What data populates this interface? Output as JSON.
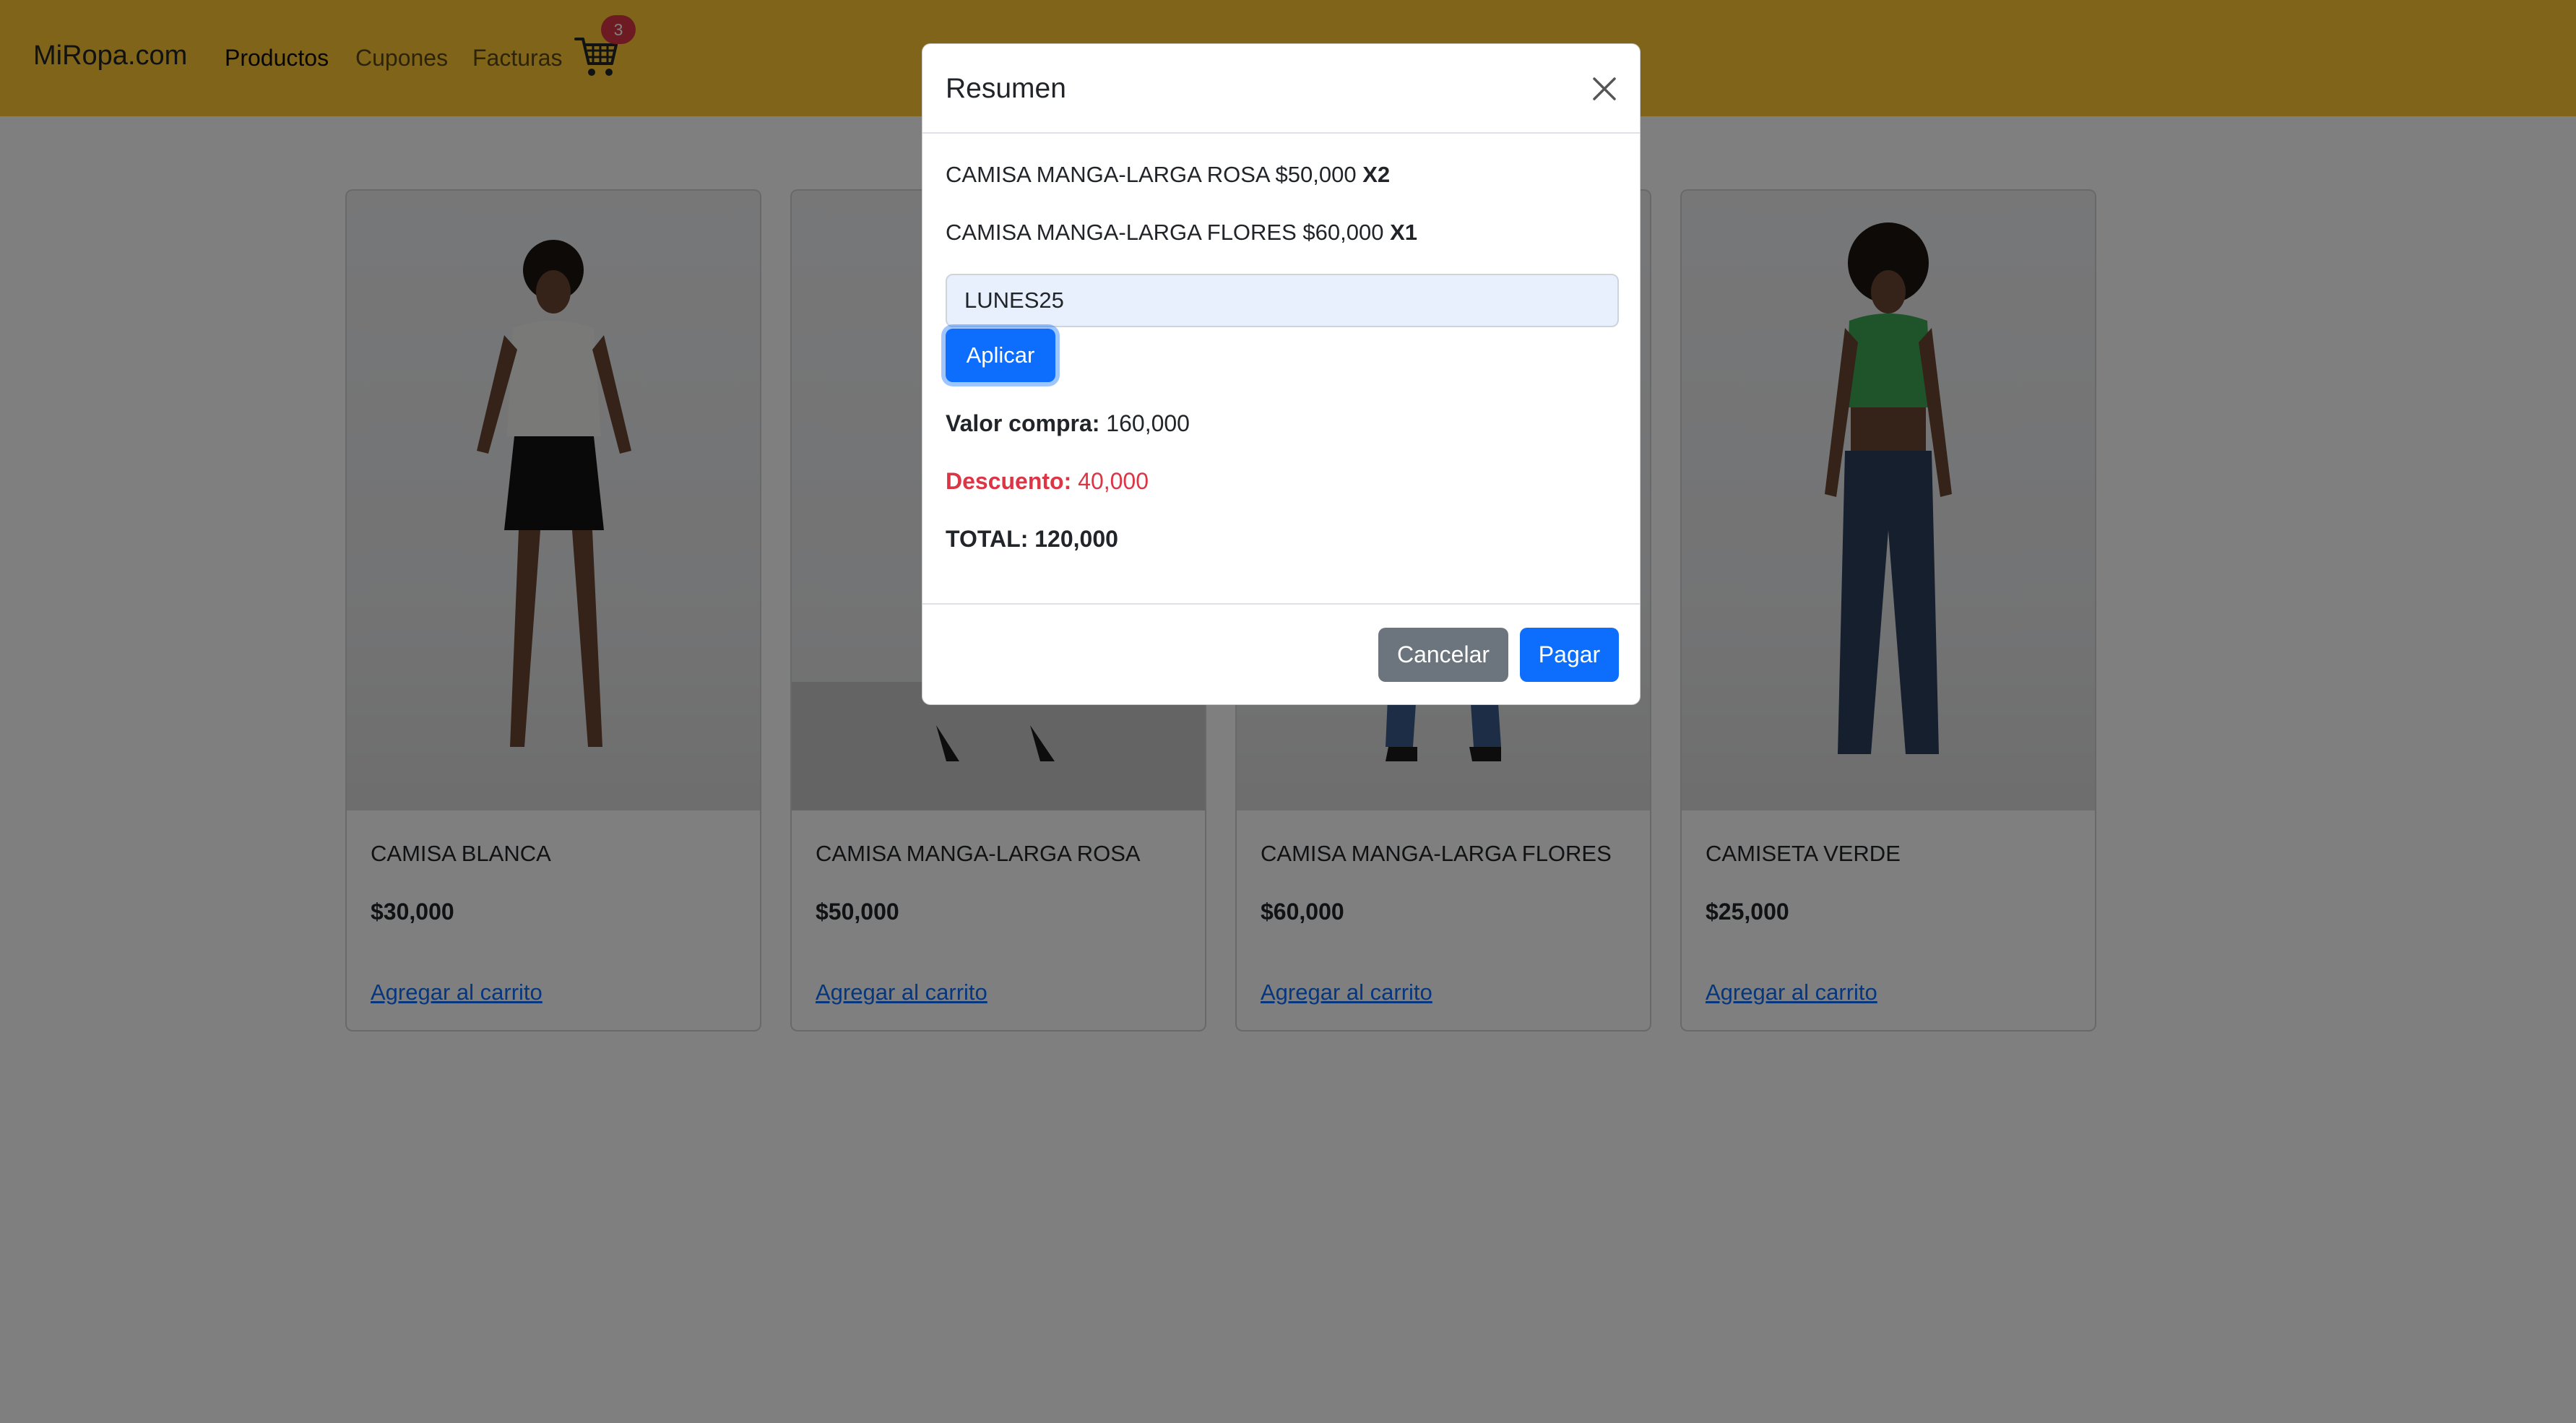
{
  "navbar": {
    "brand": "MiRopa.com",
    "links": [
      {
        "label": "Productos",
        "active": true
      },
      {
        "label": "Cupones",
        "active": false
      },
      {
        "label": "Facturas",
        "active": false
      }
    ],
    "cart_icon": "cart-icon",
    "cart_count": "3"
  },
  "products": [
    {
      "name": "CAMISA BLANCA",
      "price": "$30,000",
      "link": "Agregar al carrito"
    },
    {
      "name": "CAMISA MANGA-LARGA ROSA",
      "price": "$50,000",
      "link": "Agregar al carrito"
    },
    {
      "name": "CAMISA MANGA-LARGA FLORES",
      "price": "$60,000",
      "link": "Agregar al carrito"
    },
    {
      "name": "CAMISETA VERDE",
      "price": "$25,000",
      "link": "Agregar al carrito"
    }
  ],
  "modal": {
    "title": "Resumen",
    "close_icon": "close-icon",
    "items": [
      {
        "text": "CAMISA MANGA-LARGA ROSA $50,000",
        "qty": "X2"
      },
      {
        "text": "CAMISA MANGA-LARGA FLORES $60,000",
        "qty": "X1"
      }
    ],
    "coupon_value": "LUNES25",
    "apply_label": "Aplicar",
    "valor_label": "Valor compra:",
    "valor_value": "160,000",
    "descuento_label": "Descuento:",
    "descuento_value": "40,000",
    "total_text": "TOTAL: 120,000",
    "cancel_label": "Cancelar",
    "pay_label": "Pagar"
  },
  "colors": {
    "navbar": "#ffc832",
    "primary": "#0d6efd",
    "secondary": "#6c757d",
    "danger": "#dc3545"
  }
}
